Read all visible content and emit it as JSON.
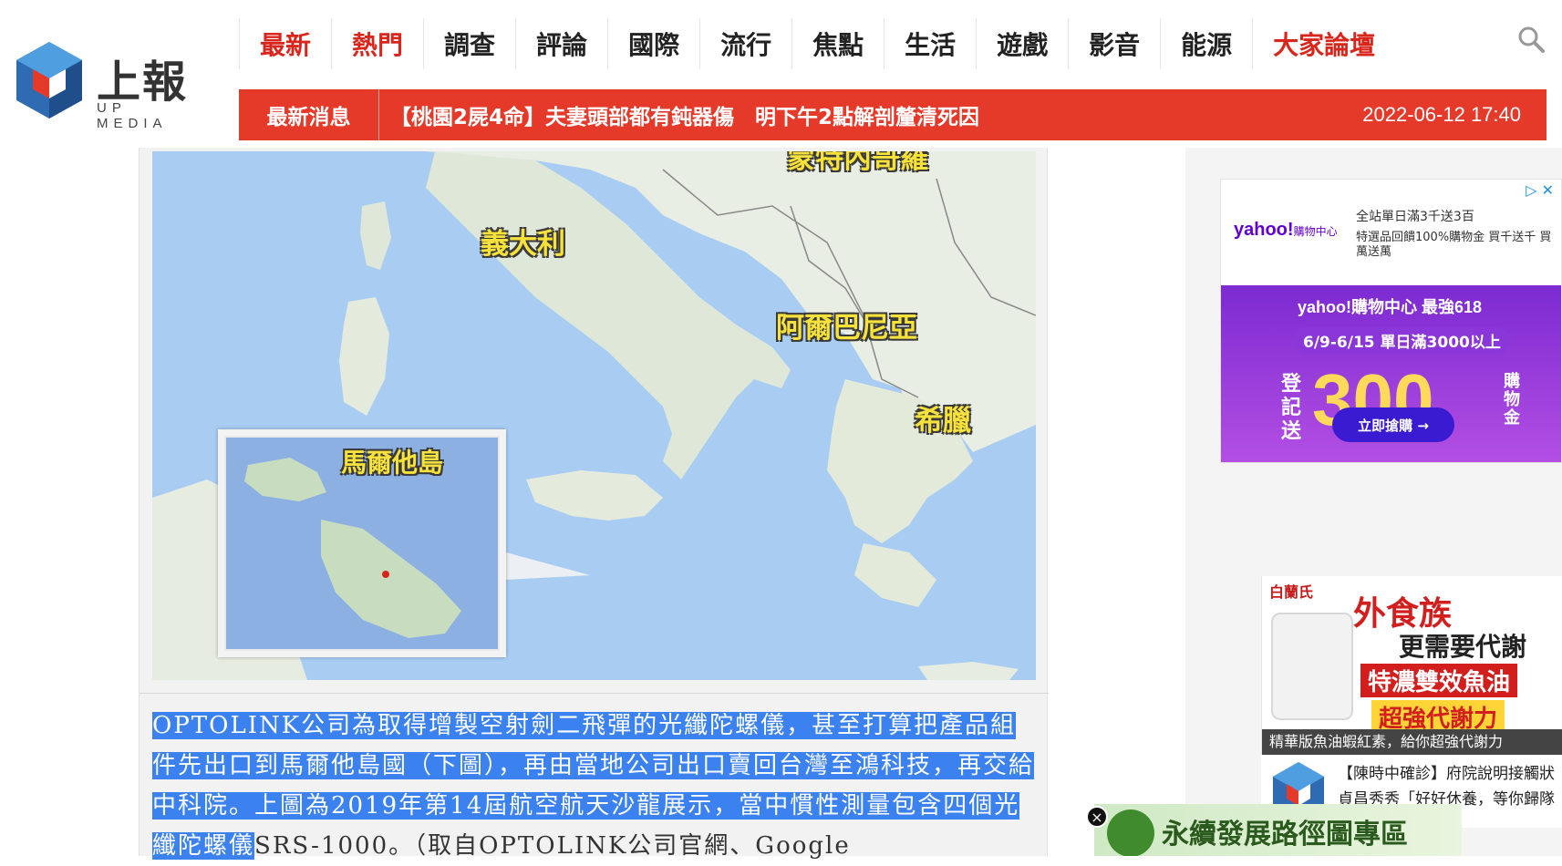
{
  "site": {
    "logo_cn": "上報",
    "logo_en": "UP MEDIA"
  },
  "nav": {
    "items": [
      {
        "label": "最新",
        "red": true
      },
      {
        "label": "熱門",
        "red": true
      },
      {
        "label": "調查",
        "red": false
      },
      {
        "label": "評論",
        "red": false
      },
      {
        "label": "國際",
        "red": false
      },
      {
        "label": "流行",
        "red": false
      },
      {
        "label": "焦點",
        "red": false
      },
      {
        "label": "生活",
        "red": false
      },
      {
        "label": "遊戲",
        "red": false
      },
      {
        "label": "影音",
        "red": false
      },
      {
        "label": "能源",
        "red": false
      },
      {
        "label": "大家論壇",
        "red": true
      }
    ],
    "search_icon": "search-icon"
  },
  "ticker": {
    "label": "最新消息",
    "headline": "【桃園2屍4命】夫妻頭部都有鈍器傷　明下午2點解剖釐清死因",
    "time": "2022-06-12 17:40"
  },
  "map": {
    "labels": {
      "italy": "義大利",
      "albania": "阿爾巴尼亞",
      "greece": "希臘",
      "malta": "馬爾他島",
      "top": "蒙特內哥羅"
    }
  },
  "caption": {
    "highlighted": "OPTOLINK公司為取得增製空射劍二飛彈的光纖陀螺儀，甚至打算把產品組件先出口到馬爾他島國（下圖），再由當地公司出口賣回台灣至鴻科技，再交給中科院。上圖為2019年第14屆航空航天沙龍展示，當中慣性測量包含四個光纖陀螺儀",
    "plain": "SRS-1000。（取自OPTOLINK公司官網、Google"
  },
  "ad_yahoo": {
    "brand": "yahoo!",
    "brand_sub": "購物中心",
    "line1": "全站單日滿3千送3百",
    "line2": "特選品回饋100%購物金 買千送千 買萬送萬",
    "banner_brand": "yahoo!購物中心 最強618",
    "banner_dates": "6/9-6/15 單日滿3000以上",
    "banner_left": "登記送",
    "banner_amount": "300",
    "banner_right": "購物金",
    "cta": "立即搶購 →"
  },
  "ad_fishoil": {
    "brand": "白蘭氏",
    "line1": "外食族",
    "line2": "更需要代謝",
    "line3": "特濃雙效魚油",
    "line4": "超強代謝力",
    "bar": "精華版魚油蝦紅素，給你超強代謝力"
  },
  "news_card": {
    "line1": "【陳時中確診】府院說明接觸狀",
    "line2": "貞昌秀秀「好好休養，等你歸隊"
  },
  "banner_bottom": {
    "text": "永續發展路徑圖專區",
    "close": "×"
  },
  "colors": {
    "accent_red": "#e5392a",
    "nav_red": "#d9261c",
    "highlight_blue": "#3b82f0"
  }
}
